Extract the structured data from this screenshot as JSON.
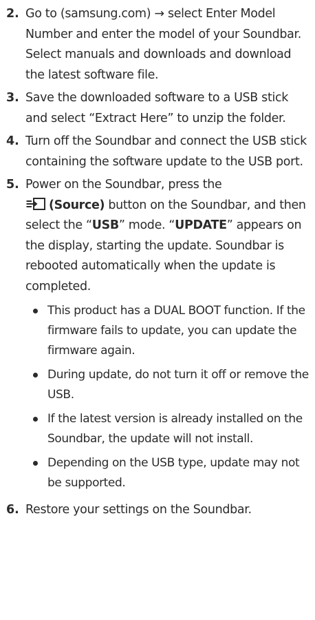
{
  "steps": [
    {
      "num": "2.",
      "text": "Go to (samsung.com) → select Enter Model Number and enter the model of your Soundbar. Select manuals and downloads and download the latest software file."
    },
    {
      "num": "3.",
      "text": "Save the downloaded software to a USB stick and select “Extract Here” to unzip the folder."
    },
    {
      "num": "4.",
      "text": "Turn off the Soundbar and connect the USB stick containing the software update to the USB port."
    },
    {
      "num": "5.",
      "intro": "Power on the Soundbar, press the",
      "icon": "source-icon",
      "source_label": "(Source)",
      "after_source": " button on the Soundbar, and then select the “",
      "usb_mode": "USB",
      "after_usb": "” mode. “",
      "update_label": "UPDATE",
      "after_update": "” appears on the display, starting the update. Soundbar is rebooted automatically when the update is completed.",
      "bullets": [
        "This product has a DUAL BOOT function. If the firmware fails to update, you can update the firmware again.",
        "During update, do not turn it off or remove the USB.",
        "If the latest version is already installed on the Soundbar, the update will not install.",
        "Depending on the USB type, update may not be supported."
      ]
    },
    {
      "num": "6.",
      "text": "Restore your settings on the Soundbar."
    }
  ]
}
